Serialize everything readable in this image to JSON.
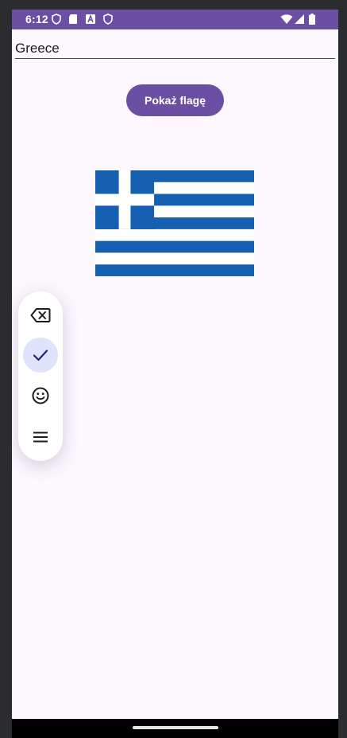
{
  "status_bar": {
    "time": "6:12",
    "left_icons": [
      "shield-icon",
      "sd-card-icon",
      "font-icon",
      "shield-icon"
    ],
    "right_icons": [
      "wifi-icon",
      "signal-icon",
      "battery-icon"
    ],
    "color": "#6a4fa3"
  },
  "input": {
    "value": "Greece"
  },
  "button": {
    "label": "Pokaż flagę",
    "color": "#6a4fa3"
  },
  "flag": {
    "country": "Greece",
    "colors": {
      "blue": "#1560b0",
      "white": "#ffffff"
    }
  },
  "floating_toolbar": {
    "items": [
      "backspace-icon",
      "check-icon",
      "emoji-icon",
      "menu-icon"
    ],
    "active_item": "check-icon"
  }
}
